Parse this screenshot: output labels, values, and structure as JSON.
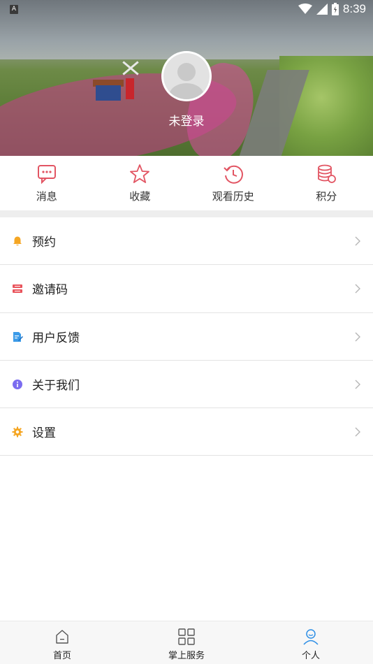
{
  "status_bar": {
    "notification_badge": "A",
    "time": "8:39"
  },
  "profile": {
    "login_text": "未登录"
  },
  "quick_actions": [
    {
      "label": "消息",
      "icon": "message-icon"
    },
    {
      "label": "收藏",
      "icon": "star-icon"
    },
    {
      "label": "观看历史",
      "icon": "history-icon"
    },
    {
      "label": "积分",
      "icon": "points-icon"
    }
  ],
  "menu": [
    {
      "label": "预约",
      "icon": "bell-icon",
      "color": "#f5a623"
    },
    {
      "label": "邀请码",
      "icon": "ticket-icon",
      "color": "#e9545c"
    },
    {
      "label": "用户反馈",
      "icon": "feedback-icon",
      "color": "#3c9be8"
    },
    {
      "label": "关于我们",
      "icon": "info-icon",
      "color": "#7b6cf0"
    },
    {
      "label": "设置",
      "icon": "gear-icon",
      "color": "#f5a623"
    }
  ],
  "tabbar": [
    {
      "label": "首页",
      "icon": "home-icon"
    },
    {
      "label": "掌上服务",
      "icon": "grid-icon"
    },
    {
      "label": "个人",
      "icon": "person-icon",
      "active": true
    }
  ],
  "colors": {
    "accent_red": "#e25563",
    "active_blue": "#2e8fe6",
    "separator": "#eeeeee"
  }
}
